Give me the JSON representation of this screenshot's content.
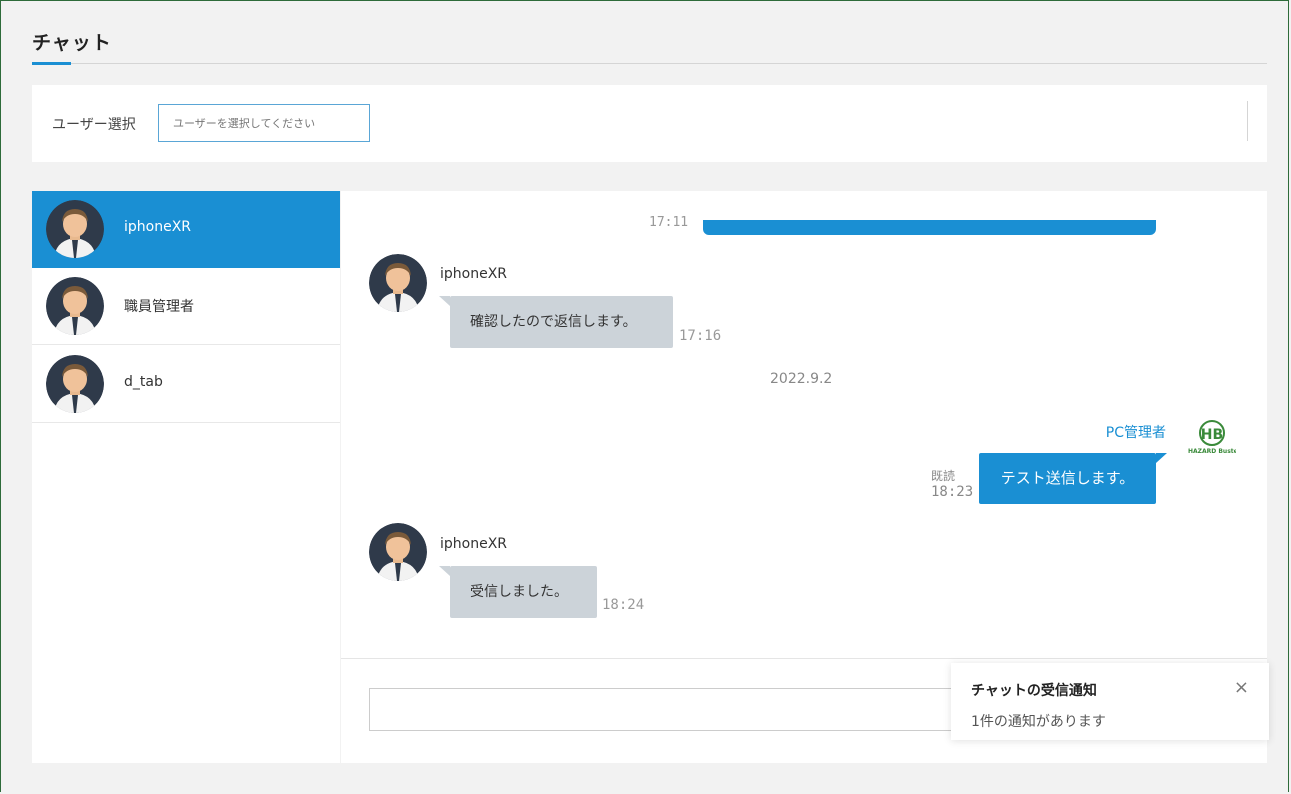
{
  "page": {
    "title": "チャット"
  },
  "user_select": {
    "label": "ユーザー選択",
    "placeholder": "ユーザーを選択してください"
  },
  "users": [
    {
      "name": "iphoneXR",
      "active": true
    },
    {
      "name": "職員管理者",
      "active": false
    },
    {
      "name": "d_tab",
      "active": false
    }
  ],
  "chat": {
    "top_time": "17:11",
    "messages": [
      {
        "sender": "iphoneXR",
        "text": "確認したので返信します。",
        "time": "17:16"
      },
      {
        "sender": "iphoneXR",
        "text": "受信しました。",
        "time": "18:24"
      }
    ],
    "date_separator": "2022.9.2",
    "my_message": {
      "sender": "PC管理者",
      "text": "テスト送信します。",
      "read": "既読",
      "time": "18:23"
    },
    "logo_text": "HAZARD Buster"
  },
  "toast": {
    "title": "チャットの受信通知",
    "body": "1件の通知があります",
    "close": "×"
  },
  "colors": {
    "accent": "#1a8fd3",
    "bubble": "#ccd3d9",
    "logo_green": "#3a8a3a"
  }
}
